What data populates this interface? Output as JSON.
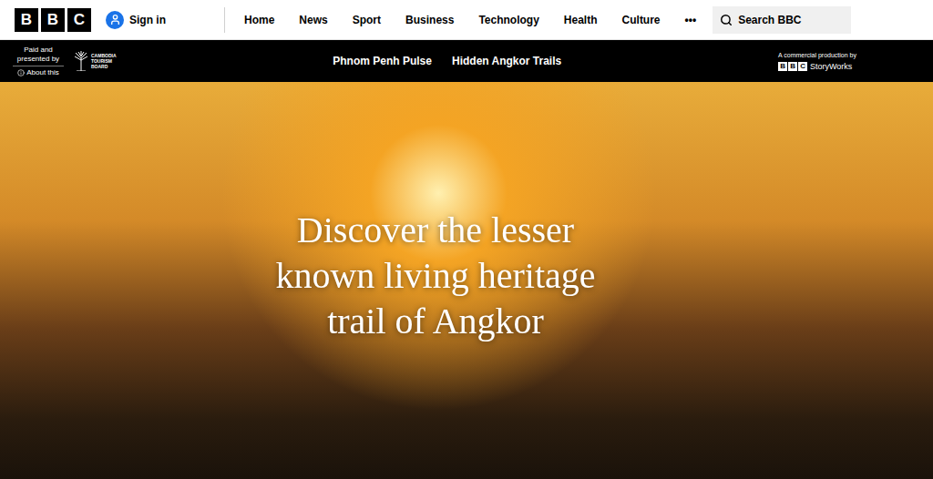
{
  "header": {
    "logo": [
      "B",
      "B",
      "C"
    ],
    "sign_in": "Sign in",
    "nav": [
      "Home",
      "News",
      "Sport",
      "Business",
      "Technology",
      "Health",
      "Culture"
    ],
    "more": "•••",
    "search": {
      "placeholder": "Search BBC"
    }
  },
  "sponsor_bar": {
    "paid_label": "Paid and presented by",
    "about": "About this",
    "sponsor_logo": [
      "CAMBODIA",
      "TOURISM",
      "BOARD"
    ],
    "links": [
      "Phnom Penh Pulse",
      "Hidden Angkor Trails"
    ],
    "production_label": "A commercial production by",
    "production_logo": {
      "letters": [
        "B",
        "B",
        "C"
      ],
      "name": "StoryWorks"
    }
  },
  "hero": {
    "headline": "Discover the lesser known living heritage trail of Angkor"
  }
}
